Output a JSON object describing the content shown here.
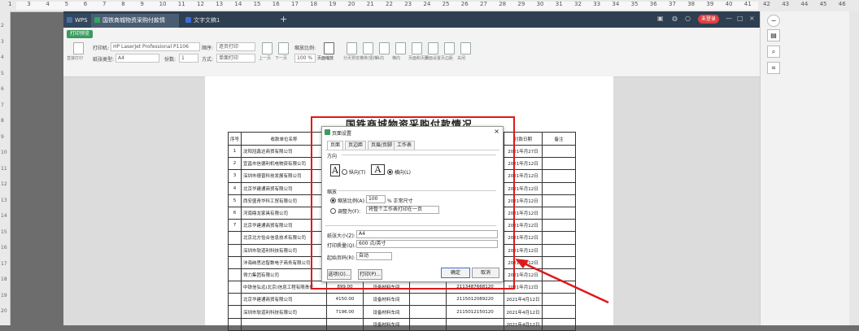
{
  "ruler": {
    "top_numbers": [
      "1",
      "3",
      "4",
      "5",
      "6",
      "7",
      "8",
      "9",
      "10",
      "11",
      "12",
      "13",
      "14",
      "15",
      "16",
      "17",
      "18",
      "19",
      "20",
      "21",
      "22",
      "23",
      "24",
      "25",
      "26",
      "27",
      "28",
      "29",
      "30",
      "31",
      "32",
      "33",
      "34",
      "35",
      "36",
      "37",
      "38",
      "39",
      "40",
      "41",
      "42",
      "43",
      "44",
      "45",
      "46"
    ],
    "left_numbers": [
      "2",
      "3",
      "4",
      "5",
      "6",
      "7",
      "8",
      "9",
      "10",
      "11",
      "12",
      "13",
      "14",
      "15",
      "16",
      "17",
      "18",
      "19",
      "20"
    ]
  },
  "tabs": [
    {
      "label": "WPS",
      "color": "#4a6fa5"
    },
    {
      "label": "国铁商城物资采购付款情况.xlsx",
      "color": "#2ea85e"
    },
    {
      "label": "文字文稿1",
      "color": "#3b6fd6"
    }
  ],
  "login_label": "未登录",
  "toolbar": {
    "mode_tab": "打印预览",
    "direct_print": "直接打印",
    "printer_label": "打印机:",
    "printer_value": "HP LaserJet Professional P1106",
    "paper_type_label": "纸张类型:",
    "paper_type_value": "A4",
    "order_label": "顺序:",
    "order_value": "逐页打印",
    "copies_label": "份数:",
    "copies_value": "1",
    "method_label": "方式:",
    "method_value": "单面打印",
    "prev_page": "上一页",
    "next_page": "下一页",
    "zoom_label": "缩放比例:",
    "zoom_value": "100 %",
    "page_zoom": "页面缩放",
    "tools": [
      "分页预览",
      "横排/竖排",
      "纵向",
      "横向",
      "页面和页脚",
      "页面设置",
      "页边距",
      "关闭"
    ]
  },
  "document": {
    "title": "国铁商城物资采购付款情况",
    "headers": [
      "序号",
      "收款单位名称",
      "",
      "",
      "",
      "",
      "付款日期",
      "备注"
    ],
    "rows": [
      [
        "1",
        "沈阳冠鑫达商贸有限公司",
        "",
        "",
        "",
        "",
        "2021年月27日",
        ""
      ],
      [
        "2",
        "宜昌市信德利机电物资有限公司",
        "",
        "",
        "",
        "",
        "2021年月12日",
        ""
      ],
      [
        "3",
        "深圳市德普科技发展有限公司",
        "",
        "",
        "",
        "",
        "2021年月12日",
        ""
      ],
      [
        "4",
        "北京华建通商贸有限公司",
        "",
        "",
        "",
        "",
        "2021年月12日",
        ""
      ],
      [
        "5",
        "西安盛青华科工贸有限公司",
        "",
        "",
        "",
        "",
        "2021年月12日",
        ""
      ],
      [
        "6",
        "河南鼎龙家具有限公司",
        "",
        "",
        "",
        "",
        "2021年月12日",
        ""
      ],
      [
        "7",
        "北京华建通商贸有限公司",
        "",
        "",
        "",
        "",
        "2021年月12日",
        ""
      ],
      [
        "",
        "北京北方恰合信息技术有限公司",
        "",
        "",
        "",
        "",
        "2021年月12日",
        ""
      ],
      [
        "",
        "深圳市软道利科技有限公司",
        "",
        "",
        "",
        "",
        "2021年月12日",
        ""
      ],
      [
        "",
        "沣海纳思达智数电子商务有限公司",
        "",
        "",
        "",
        "",
        "2021年月12日",
        ""
      ],
      [
        "",
        "得力集团有限公司",
        "",
        "",
        "",
        "",
        "2021年月12日",
        ""
      ],
      [
        "",
        "中铁信弘远(北京)信息工程有限责任",
        "899.00",
        "设备材料车间",
        "",
        "2113487668120",
        "2021年月12日",
        ""
      ],
      [
        "",
        "北京华建通商贸有限公司",
        "4150.00",
        "设备材料车间",
        "",
        "2115012089220",
        "2021年4月12日",
        ""
      ],
      [
        "",
        "深圳市软道利科技有限公司",
        "7196.00",
        "设备材料车间",
        "",
        "2115012150120",
        "2021年4月12日",
        ""
      ],
      [
        "",
        "",
        "",
        "设备材料车间",
        "",
        "",
        "2021年4月12日",
        ""
      ]
    ]
  },
  "dialog": {
    "title": "页面设置",
    "close": "×",
    "tabs": [
      "页面",
      "页边距",
      "页眉/页脚",
      "工作表"
    ],
    "orientation_label": "方向",
    "portrait": "纵向(T)",
    "landscape": "横向(L)",
    "scale_label": "缩放",
    "scale_radio": "缩放比例(A):",
    "scale_value": "100",
    "scale_suffix": "% 正常尺寸",
    "fit_radio": "调整为(F):",
    "fit_value": "将整个工作表打印在一页",
    "paper_size_label": "纸张大小(Z):",
    "paper_size_value": "A4",
    "quality_label": "打印质量(Q):",
    "quality_value": "600 点/英寸",
    "first_page_label": "起始页码(R):",
    "first_page_value": "自动",
    "options_btn": "选项(O)...",
    "print_btn": "打印(P)...",
    "ok_btn": "确定",
    "cancel_btn": "取消"
  },
  "colors": {
    "accent_red": "#e01818",
    "wps_green": "#3c9a5f",
    "titlebar": "#2e3f52"
  }
}
